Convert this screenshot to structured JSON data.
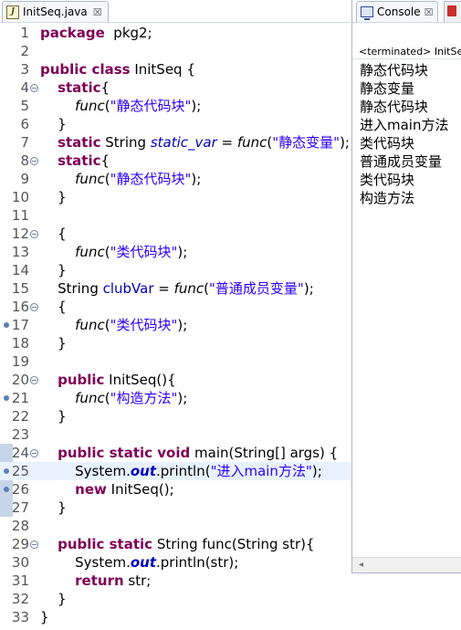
{
  "editor": {
    "tab_title": "InitSeq.java",
    "tab_close": "☒",
    "lines": [
      {
        "n": "1",
        "fold": false,
        "dot": false,
        "cur": false,
        "tokens": [
          [
            "kw",
            "package"
          ],
          [
            "",
            "  pkg2;"
          ]
        ]
      },
      {
        "n": "2",
        "fold": false,
        "dot": false,
        "cur": false,
        "tokens": []
      },
      {
        "n": "3",
        "fold": false,
        "dot": false,
        "cur": false,
        "tokens": [
          [
            "kw",
            "public class"
          ],
          [
            "",
            " InitSeq {"
          ]
        ]
      },
      {
        "n": "4",
        "fold": true,
        "dot": false,
        "cur": false,
        "tokens": [
          [
            "",
            "    "
          ],
          [
            "kw",
            "static"
          ],
          [
            "",
            "{"
          ]
        ]
      },
      {
        "n": "5",
        "fold": false,
        "dot": false,
        "cur": false,
        "tokens": [
          [
            "",
            "        "
          ],
          [
            "it",
            "func"
          ],
          [
            "",
            "("
          ],
          [
            "str",
            "\"静态代码块\""
          ],
          [
            "",
            ");"
          ]
        ]
      },
      {
        "n": "6",
        "fold": false,
        "dot": false,
        "cur": false,
        "tokens": [
          [
            "",
            "    }"
          ]
        ]
      },
      {
        "n": "7",
        "fold": false,
        "dot": false,
        "cur": false,
        "tokens": [
          [
            "",
            "    "
          ],
          [
            "kw",
            "static"
          ],
          [
            "",
            " String "
          ],
          [
            "fldi",
            "static_var"
          ],
          [
            "",
            " = "
          ],
          [
            "it",
            "func"
          ],
          [
            "",
            "("
          ],
          [
            "str",
            "\"静态变量\""
          ],
          [
            "",
            ");"
          ]
        ]
      },
      {
        "n": "8",
        "fold": true,
        "dot": false,
        "cur": false,
        "tokens": [
          [
            "",
            "    "
          ],
          [
            "kw",
            "static"
          ],
          [
            "",
            "{"
          ]
        ]
      },
      {
        "n": "9",
        "fold": false,
        "dot": false,
        "cur": false,
        "tokens": [
          [
            "",
            "        "
          ],
          [
            "it",
            "func"
          ],
          [
            "",
            "("
          ],
          [
            "str",
            "\"静态代码块\""
          ],
          [
            "",
            ");"
          ]
        ]
      },
      {
        "n": "10",
        "fold": false,
        "dot": false,
        "cur": false,
        "tokens": [
          [
            "",
            "    }"
          ]
        ]
      },
      {
        "n": "11",
        "fold": false,
        "dot": false,
        "cur": false,
        "tokens": []
      },
      {
        "n": "12",
        "fold": true,
        "dot": false,
        "cur": false,
        "tokens": [
          [
            "",
            "    {"
          ]
        ]
      },
      {
        "n": "13",
        "fold": false,
        "dot": false,
        "cur": false,
        "tokens": [
          [
            "",
            "        "
          ],
          [
            "it",
            "func"
          ],
          [
            "",
            "("
          ],
          [
            "str",
            "\"类代码块\""
          ],
          [
            "",
            ");"
          ]
        ]
      },
      {
        "n": "14",
        "fold": false,
        "dot": false,
        "cur": false,
        "tokens": [
          [
            "",
            "    }"
          ]
        ]
      },
      {
        "n": "15",
        "fold": false,
        "dot": false,
        "cur": false,
        "tokens": [
          [
            "",
            "    String "
          ],
          [
            "fld",
            "clubVar"
          ],
          [
            "",
            " = "
          ],
          [
            "it",
            "func"
          ],
          [
            "",
            "("
          ],
          [
            "str",
            "\"普通成员变量\""
          ],
          [
            "",
            ");"
          ]
        ]
      },
      {
        "n": "16",
        "fold": true,
        "dot": false,
        "cur": false,
        "tokens": [
          [
            "",
            "    {"
          ]
        ]
      },
      {
        "n": "17",
        "fold": false,
        "dot": true,
        "cur": false,
        "tokens": [
          [
            "",
            "        "
          ],
          [
            "it",
            "func"
          ],
          [
            "",
            "("
          ],
          [
            "str",
            "\"类代码块\""
          ],
          [
            "",
            ");"
          ]
        ]
      },
      {
        "n": "18",
        "fold": false,
        "dot": false,
        "cur": false,
        "tokens": [
          [
            "",
            "    }"
          ]
        ]
      },
      {
        "n": "19",
        "fold": false,
        "dot": false,
        "cur": false,
        "tokens": []
      },
      {
        "n": "20",
        "fold": true,
        "dot": false,
        "cur": false,
        "tokens": [
          [
            "",
            "    "
          ],
          [
            "kw",
            "public"
          ],
          [
            "",
            " InitSeq(){"
          ]
        ]
      },
      {
        "n": "21",
        "fold": false,
        "dot": true,
        "cur": false,
        "tokens": [
          [
            "",
            "        "
          ],
          [
            "it",
            "func"
          ],
          [
            "",
            "("
          ],
          [
            "str",
            "\"构造方法\""
          ],
          [
            "",
            ");"
          ]
        ]
      },
      {
        "n": "22",
        "fold": false,
        "dot": false,
        "cur": false,
        "tokens": [
          [
            "",
            "    }"
          ]
        ]
      },
      {
        "n": "23",
        "fold": false,
        "dot": false,
        "cur": false,
        "tokens": []
      },
      {
        "n": "24",
        "fold": true,
        "dot": false,
        "cur": false,
        "tokens": [
          [
            "",
            "    "
          ],
          [
            "kw",
            "public static void"
          ],
          [
            "",
            " main(String[] args) {"
          ]
        ]
      },
      {
        "n": "25",
        "fold": false,
        "dot": true,
        "cur": true,
        "tokens": [
          [
            "",
            "        System."
          ],
          [
            "sfld",
            "out"
          ],
          [
            "",
            ".println("
          ],
          [
            "str",
            "\"进入main方法\""
          ],
          [
            "",
            ");"
          ]
        ]
      },
      {
        "n": "26",
        "fold": false,
        "dot": true,
        "cur": false,
        "tokens": [
          [
            "",
            "        "
          ],
          [
            "kw",
            "new"
          ],
          [
            "",
            " InitSeq();"
          ]
        ]
      },
      {
        "n": "27",
        "fold": false,
        "dot": false,
        "cur": false,
        "tokens": [
          [
            "",
            "    }"
          ]
        ]
      },
      {
        "n": "28",
        "fold": false,
        "dot": false,
        "cur": false,
        "tokens": []
      },
      {
        "n": "29",
        "fold": true,
        "dot": false,
        "cur": false,
        "tokens": [
          [
            "",
            "    "
          ],
          [
            "kw",
            "public static"
          ],
          [
            "",
            " String func(String str){"
          ]
        ]
      },
      {
        "n": "30",
        "fold": false,
        "dot": false,
        "cur": false,
        "tokens": [
          [
            "",
            "        System."
          ],
          [
            "sfld",
            "out"
          ],
          [
            "",
            ".println(str);"
          ]
        ]
      },
      {
        "n": "31",
        "fold": false,
        "dot": false,
        "cur": false,
        "tokens": [
          [
            "",
            "        "
          ],
          [
            "kw",
            "return"
          ],
          [
            "",
            " str;"
          ]
        ]
      },
      {
        "n": "32",
        "fold": false,
        "dot": false,
        "cur": false,
        "tokens": [
          [
            "",
            "    }"
          ]
        ]
      },
      {
        "n": "33",
        "fold": false,
        "dot": false,
        "cur": false,
        "tokens": [
          [
            "",
            "}"
          ]
        ]
      }
    ]
  },
  "console": {
    "tab_title": "Console",
    "tab_close": "☒",
    "status": "<terminated> InitSeq",
    "output": [
      "静态代码块",
      "静态变量",
      "静态代码块",
      "进入main方法",
      "类代码块",
      "普通成员变量",
      "类代码块",
      "构造方法"
    ],
    "scroll_left": "◂"
  },
  "colors": {
    "keyword": "#7f0055",
    "string": "#2a00ff",
    "field": "#0000c0",
    "current_line": "#e8f2fe"
  }
}
